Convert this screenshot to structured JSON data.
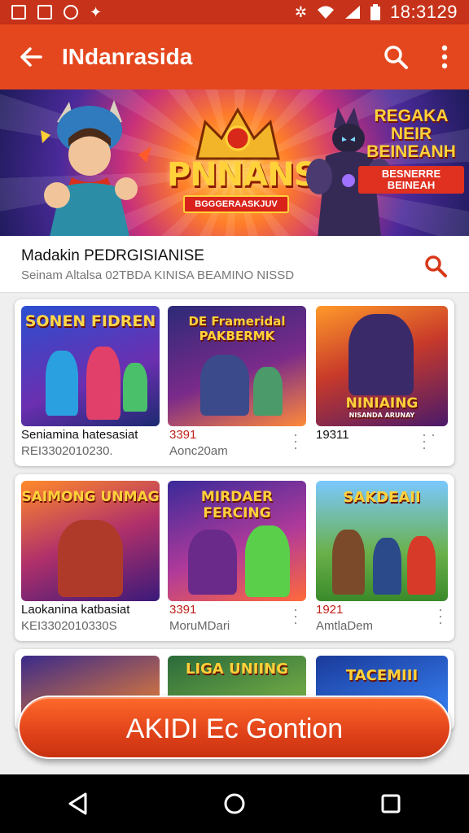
{
  "status_bar": {
    "time": "18:3129",
    "left_icons": [
      "gallery-icon",
      "photo-icon",
      "map-pin-icon",
      "game-icon"
    ],
    "right_icons": [
      "vibrate-icon",
      "wifi-icon",
      "signal-icon",
      "battery-icon"
    ]
  },
  "app_bar": {
    "title": "INdanrasida",
    "back_icon": "arrow-left-icon",
    "actions": [
      "search-icon",
      "more-vert-icon"
    ]
  },
  "hero": {
    "logo": "PNNANSIA",
    "ribbon": "BGGGERAASKJUV",
    "promo_title": "REGAKA NEIR BEINEANH",
    "promo_badge": "BESNERRE BEINEAH"
  },
  "info": {
    "title": "Madakin PEDRGISIANISE",
    "subtitle": "Seinam Altalsa 02TBDA KINISA BEAMINO NISSD"
  },
  "rows": [
    {
      "items": [
        {
          "art": "SONEN FIDREN",
          "line1": "Seniamina hatesasiat",
          "line2": "REI3302010230."
        },
        {
          "art": "DE Frameridal PAKBERMK",
          "line1": "3391",
          "line2": "Aonc20am"
        },
        {
          "art": "NINIAING",
          "art_sub": "NISANDA ARUNAY",
          "line1": "19311",
          "line2": ""
        }
      ]
    },
    {
      "items": [
        {
          "art": "SAIMONG UNMAG",
          "line1": "Laokanina katbasiat",
          "line2": "KEI3302010330S"
        },
        {
          "art": "MIRDAER FERCING",
          "line1": "3391",
          "line2": "MoruMDari"
        },
        {
          "art": "SAKDEAII",
          "line1": "1921",
          "line2": "AmtlaDem"
        }
      ]
    },
    {
      "items": [
        {
          "art": ""
        },
        {
          "art": "LIGA UNIING"
        },
        {
          "art": "TACEMIII"
        }
      ]
    }
  ],
  "cta": {
    "label": "AKIDI Ec Gontion"
  },
  "nav": [
    "back-triangle-icon",
    "home-circle-icon",
    "recents-square-icon"
  ],
  "colors": {
    "primary": "#e4471e",
    "status": "#c7321a",
    "accent_text": "#c0201a"
  }
}
